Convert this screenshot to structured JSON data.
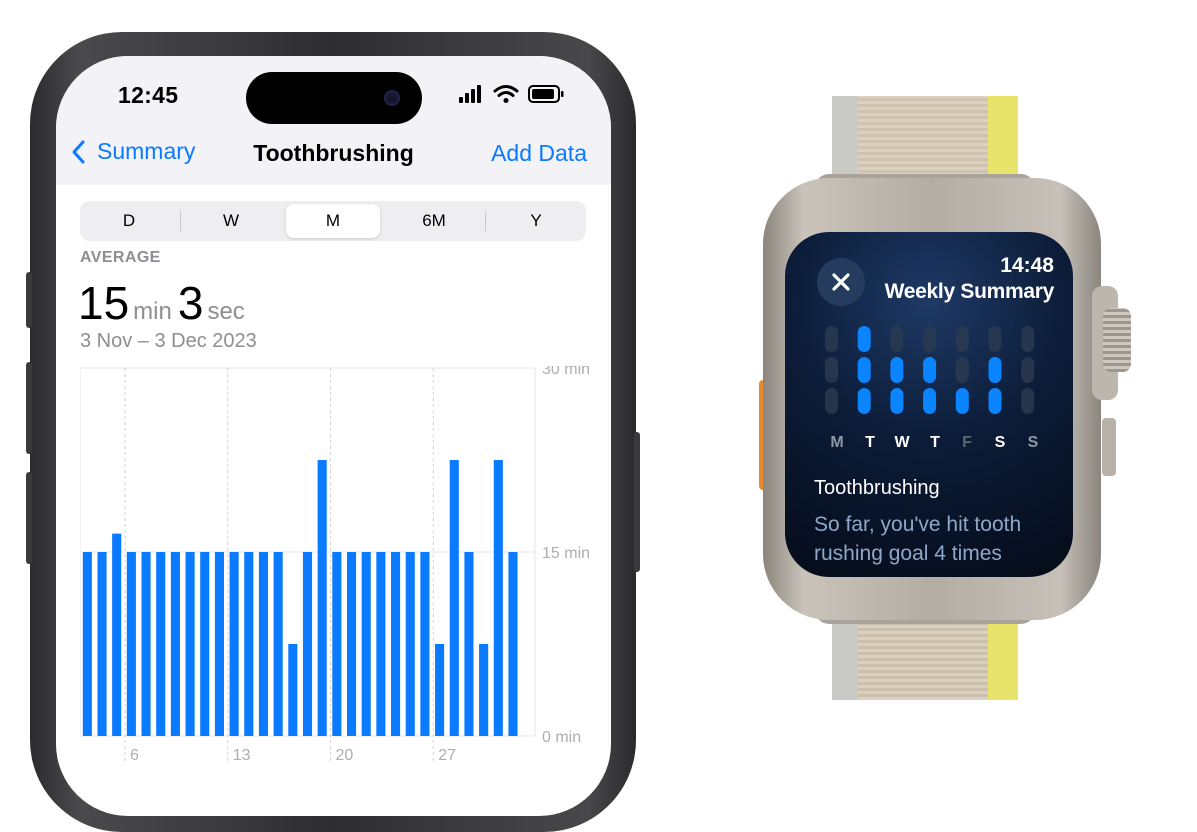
{
  "phone": {
    "status": {
      "time": "12:45"
    },
    "nav": {
      "back_label": "Summary",
      "title": "Toothbrushing",
      "action_label": "Add Data"
    },
    "segments": [
      "D",
      "W",
      "M",
      "6M",
      "Y"
    ],
    "selected_segment": "M",
    "average": {
      "label": "AVERAGE",
      "minutes": "15",
      "minutes_unit": "min",
      "seconds": "3",
      "seconds_unit": "sec",
      "date_range": "3 Nov – 3 Dec 2023"
    },
    "accent_color": "#0a7aff"
  },
  "chart_data": {
    "type": "bar",
    "title": "",
    "xlabel": "",
    "ylabel": "",
    "ylim": [
      0,
      30
    ],
    "y_tick_labels": [
      "30 min",
      "15 min",
      "0 min"
    ],
    "y_ticks": [
      30,
      15,
      0
    ],
    "x_tick_labels": [
      "6",
      "13",
      "20",
      "27"
    ],
    "x_tick_days": [
      6,
      13,
      20,
      27
    ],
    "categories": [
      "3",
      "4",
      "5",
      "6",
      "7",
      "8",
      "9",
      "10",
      "11",
      "12",
      "13",
      "14",
      "15",
      "16",
      "17",
      "18",
      "19",
      "20",
      "21",
      "22",
      "23",
      "24",
      "25",
      "26",
      "27",
      "28",
      "29",
      "30",
      "1",
      "2",
      "3"
    ],
    "values": [
      15,
      15,
      16.5,
      15,
      15,
      15,
      15,
      15,
      15,
      15,
      15,
      15,
      15,
      15,
      7.5,
      15,
      22.5,
      15,
      15,
      15,
      15,
      15,
      15,
      15,
      7.5,
      22.5,
      15,
      7.5,
      22.5,
      15
    ],
    "bar_color": "#0a7aff",
    "grid": true
  },
  "watch": {
    "time": "14:48",
    "title": "Weekly Summary",
    "close_icon": "close-icon",
    "days": [
      "M",
      "T",
      "W",
      "T",
      "F",
      "S",
      "S"
    ],
    "day_goals_met": [
      0,
      2,
      2,
      2,
      1,
      2,
      0
    ],
    "day_segments": [
      [
        false,
        false,
        false
      ],
      [
        true,
        true,
        true
      ],
      [
        false,
        true,
        true
      ],
      [
        false,
        true,
        true
      ],
      [
        false,
        false,
        true
      ],
      [
        false,
        true,
        true
      ],
      [
        false,
        false,
        false
      ]
    ],
    "metric_label": "Toothbrushing",
    "message": "So far, you've hit tooth rushing goal 4 times"
  }
}
